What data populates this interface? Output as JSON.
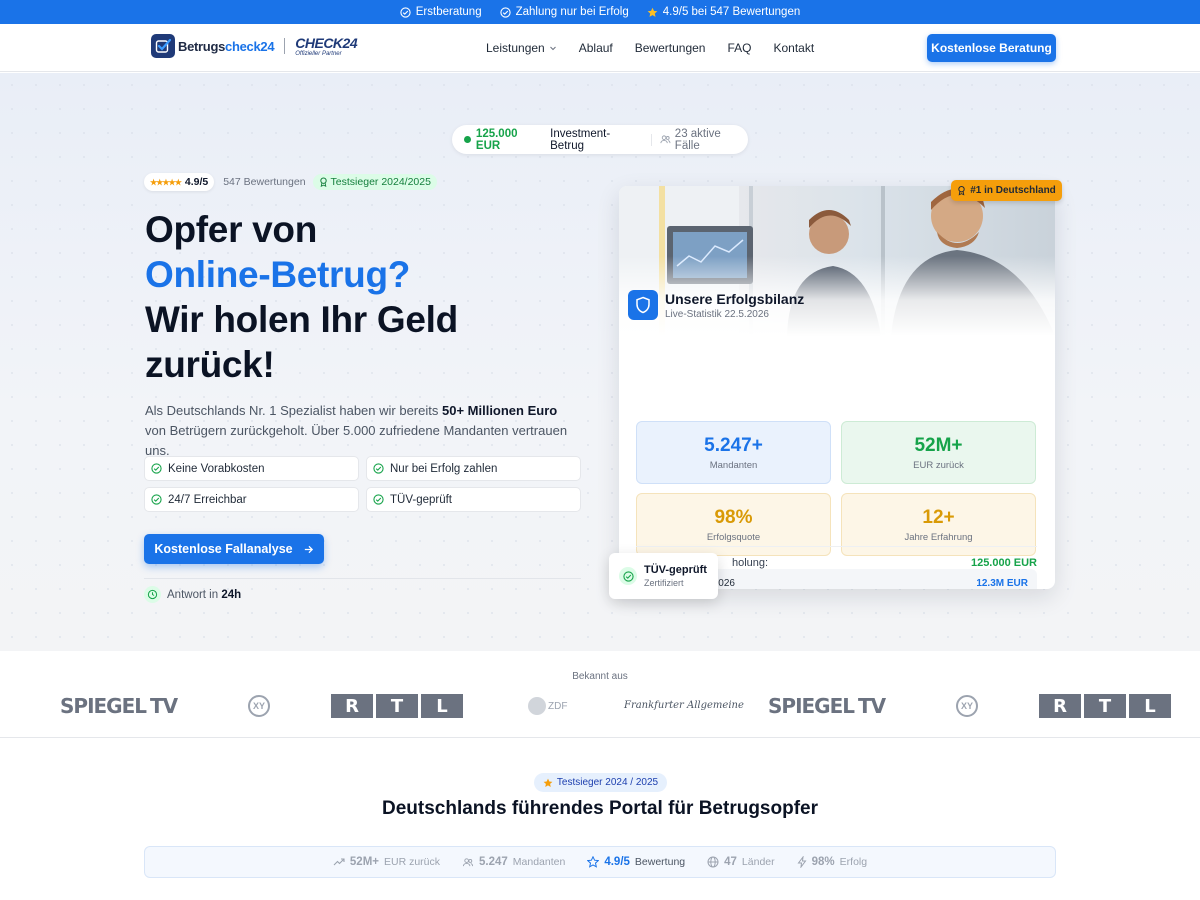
{
  "topbar": {
    "items": [
      "Erstberatung",
      "Zahlung nur bei Erfolg",
      "4.9/5 bei 547 Bewertungen"
    ]
  },
  "nav": {
    "logo": {
      "brand_a": "Betrugs",
      "brand_b": "check24",
      "partner": "CHECK24",
      "partner_sub": "Offizieller Partner"
    },
    "menu": [
      "Leistungen",
      "Ablauf",
      "Bewertungen",
      "FAQ",
      "Kontakt"
    ],
    "cta": "Kostenlose Beratung"
  },
  "hero": {
    "ticker": {
      "amount": "125.000 EUR",
      "type": "Investment-Betrug",
      "cases": "23 aktive Fälle"
    },
    "rating": {
      "score": "4.9/5",
      "count": "547 Bewertungen",
      "badge": "Testsieger 2024/2025"
    },
    "headline": {
      "l1": "Opfer von",
      "l2": "Online-Betrug?",
      "l3": "Wir holen Ihr Geld",
      "l4": "zurück!"
    },
    "lead": {
      "a": "Als Deutschlands Nr. 1 Spezialist haben wir bereits ",
      "b": "50+ Millionen Euro",
      "c": " von Betrügern zurückgeholt. Über 5.000 zufriedene Mandanten vertrauen uns."
    },
    "features": [
      "Keine Vorabkosten",
      "Nur bei Erfolg zahlen",
      "24/7 Erreichbar",
      "TÜV-geprüft"
    ],
    "cta": "Kostenlose Fallanalyse",
    "response": {
      "label": "Antwort in ",
      "value": "24h"
    }
  },
  "card": {
    "badge": "#1 in Deutschland",
    "title": "Unsere Erfolgsbilanz",
    "subtitle": "Live-Statistik 22.5.2026",
    "stats": [
      {
        "value": "5.247+",
        "label": "Mandanten"
      },
      {
        "value": "52M+",
        "label": "EUR zurück"
      },
      {
        "value": "98%",
        "label": "Erfolgsquote"
      },
      {
        "value": "12+",
        "label": "Jahre Erfahrung"
      }
    ],
    "progress": {
      "label": "Rückholungen 2026",
      "value": "12.3M EUR",
      "fraction": 0.82
    },
    "recovery": {
      "label": "holung:",
      "value": "125.000 EUR"
    },
    "tuv": {
      "title": "TÜV-geprüft",
      "subtitle": "Zertifiziert"
    }
  },
  "press": {
    "label": "Bekannt aus",
    "spiegel": "SPIEGEL",
    "tv": "TV",
    "rtl": [
      "R",
      "T",
      "L"
    ],
    "xy": "XY",
    "zdf": "ZDF",
    "faz": "Frankfurter Allgemeine"
  },
  "section": {
    "badge": "Testsieger 2024 / 2025",
    "title": "Deutschlands führendes Portal für Betrugsopfer",
    "stats": [
      {
        "value": "52M+",
        "label": "EUR zurück"
      },
      {
        "value": "5.247",
        "label": "Mandanten"
      },
      {
        "value": "4.9/5",
        "label": "Bewertung"
      },
      {
        "value": "47",
        "label": "Länder"
      },
      {
        "value": "98%",
        "label": "Erfolg"
      }
    ]
  }
}
